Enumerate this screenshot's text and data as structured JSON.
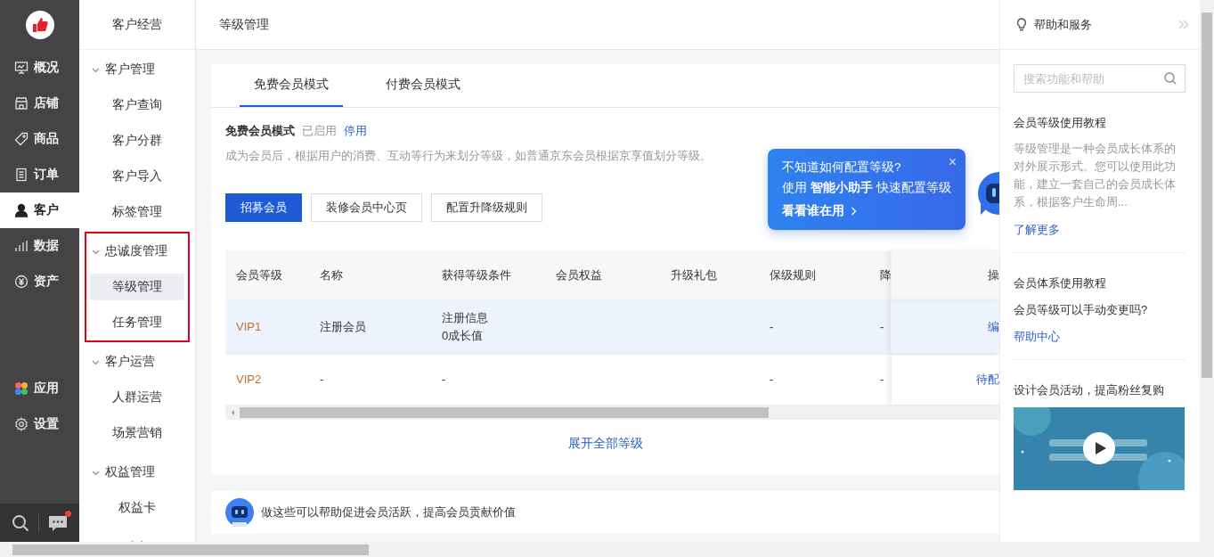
{
  "rail": {
    "items": [
      {
        "label": "概况",
        "selected": false
      },
      {
        "label": "店铺",
        "selected": false
      },
      {
        "label": "商品",
        "selected": false
      },
      {
        "label": "订单",
        "selected": false
      },
      {
        "label": "客户",
        "selected": true
      },
      {
        "label": "数据",
        "selected": false
      },
      {
        "label": "资产",
        "selected": false
      }
    ],
    "apps": [
      {
        "label": "应用",
        "selected": false
      },
      {
        "label": "设置",
        "selected": false
      }
    ],
    "chat_unread": true
  },
  "nav": {
    "title": "客户经营",
    "groups": [
      {
        "label": "客户管理",
        "expanded": true,
        "highlighted": false,
        "children": [
          {
            "label": "客户查询",
            "selected": false
          },
          {
            "label": "客户分群",
            "selected": false
          },
          {
            "label": "客户导入",
            "selected": false
          },
          {
            "label": "标签管理",
            "selected": false
          }
        ]
      },
      {
        "label": "忠诚度管理",
        "expanded": true,
        "highlighted": true,
        "children": [
          {
            "label": "等级管理",
            "selected": true
          },
          {
            "label": "任务管理",
            "selected": false
          }
        ]
      },
      {
        "label": "客户运营",
        "expanded": true,
        "highlighted": false,
        "children": [
          {
            "label": "人群运营",
            "selected": false
          },
          {
            "label": "场景营销",
            "selected": false
          }
        ]
      },
      {
        "label": "权益管理",
        "expanded": true,
        "highlighted": false,
        "children": [
          {
            "label": "权益卡",
            "selected": false
          }
        ]
      }
    ]
  },
  "page": {
    "title": "等级管理"
  },
  "tabs": [
    {
      "label": "免费会员模式",
      "selected": true
    },
    {
      "label": "付费会员模式",
      "selected": false
    }
  ],
  "mode": {
    "name": "免费会员模式",
    "status": "已启用",
    "action": "停用",
    "description": "成为会员后，根据用户的消费、互动等行为来划分等级，如普通京东会员根据京享值划分等级。"
  },
  "buttons": [
    {
      "label": "招募会员",
      "primary": true
    },
    {
      "label": "装修会员中心页",
      "primary": false
    },
    {
      "label": "配置升降级规则",
      "primary": false
    }
  ],
  "table": {
    "columns": [
      "会员等级",
      "名称",
      "获得等级条件",
      "会员权益",
      "升级礼包",
      "保级规则",
      "降",
      "操"
    ],
    "rows": [
      {
        "highlighted": true,
        "cells": [
          "VIP1",
          "注册会员",
          "注册信息\n0成长值",
          null,
          null,
          "-",
          "-",
          "编"
        ]
      },
      {
        "highlighted": false,
        "cells": [
          "VIP2",
          "-",
          "-",
          null,
          null,
          "-",
          "-",
          "待配"
        ]
      }
    ]
  },
  "expand_link": "展开全部等级",
  "tip": {
    "question": "不知道如何配置等级?",
    "line": "使用 **智能小助手** 快速配置等级",
    "link": "看看谁在用",
    "close": "×"
  },
  "promo": {
    "text": "做这些可以帮助促进会员活跃，提高会员贡献价值"
  },
  "help": {
    "title": "帮助和服务",
    "search": {
      "placeholder": "搜索功能和帮助"
    },
    "article": {
      "title": "会员等级使用教程",
      "text": "等级管理是一种会员成长体系的对外展示形式。您可以使用此功能，建立一套自己的会员成长体系，根据客户生命周...",
      "link": "了解更多"
    },
    "faq": {
      "title": "会员体系使用教程",
      "question": "会员等级可以手动变更吗?",
      "link": "帮助中心"
    },
    "video": {
      "title": "设计会员活动，提高粉丝复购",
      "kind": "picture"
    }
  }
}
